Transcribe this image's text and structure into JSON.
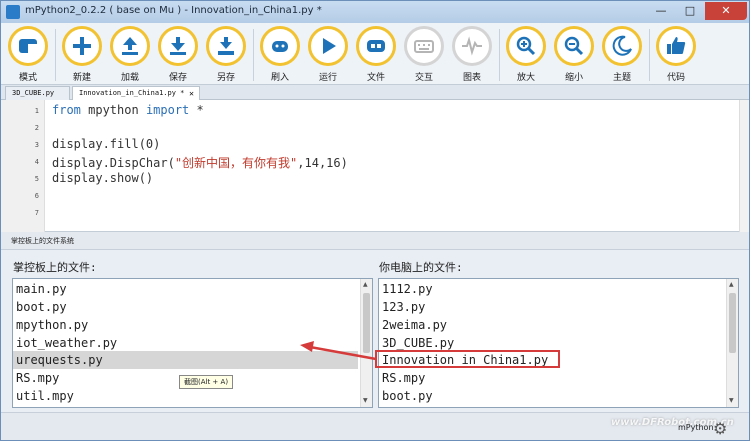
{
  "window": {
    "title": "mPython2_0.2.2 ( base on Mu ) - Innovation_in_China1.py *",
    "minimize": "—",
    "maximize": "□",
    "close": "✕"
  },
  "toolbar": {
    "buttons": [
      {
        "label": "模式",
        "icon": "mode-icon"
      },
      {
        "label": "新建",
        "icon": "plus-icon"
      },
      {
        "label": "加载",
        "icon": "upload-icon"
      },
      {
        "label": "保存",
        "icon": "download-icon"
      },
      {
        "label": "另存",
        "icon": "save-as-icon"
      },
      {
        "label": "刷入",
        "icon": "flash-icon"
      },
      {
        "label": "运行",
        "icon": "play-icon"
      },
      {
        "label": "文件",
        "icon": "files-icon"
      },
      {
        "label": "交互",
        "icon": "keyboard-icon"
      },
      {
        "label": "图表",
        "icon": "plotter-icon"
      },
      {
        "label": "放大",
        "icon": "zoom-in-icon"
      },
      {
        "label": "缩小",
        "icon": "zoom-out-icon"
      },
      {
        "label": "主题",
        "icon": "moon-icon"
      },
      {
        "label": "代码",
        "icon": "thumbs-up-icon"
      }
    ]
  },
  "tabs": [
    {
      "label": "3D_CUBE.py",
      "close": ""
    },
    {
      "label": "Innovation_in_China1.py *",
      "close": "✕"
    }
  ],
  "editor": {
    "line_numbers": [
      "1",
      "2",
      "3",
      "4",
      "5",
      "6",
      "7"
    ],
    "lines": [
      {
        "kw": "from",
        "mid": " mpython ",
        "kw2": "import",
        "rest": " *"
      },
      {
        "text": ""
      },
      {
        "text": "display.fill(0)"
      },
      {
        "pre": "display.DispChar(",
        "str": "\"创新中国，有你有我\"",
        "post": ",14,16)"
      },
      {
        "text": "display.show()"
      },
      {
        "text": ""
      },
      {
        "text": ""
      }
    ]
  },
  "files_panel": {
    "header": "掌控板上的文件系统",
    "device_title": "掌控板上的文件:",
    "computer_title": "你电脑上的文件:",
    "device_files": [
      "main.py",
      "boot.py",
      "mpython.py",
      "iot_weather.py",
      "urequests.py",
      "RS.mpy",
      "util.mpy"
    ],
    "computer_files": [
      "1112.py",
      "123.py",
      "2weima.py",
      "3D_CUBE.py",
      "Innovation_in_China1.py",
      "RS.mpy",
      "boot.py"
    ],
    "selected_device_file": "urequests.py",
    "tooltip": "截图(Alt + A)"
  },
  "status": {
    "mode": "mPython",
    "watermark": "www.DFRobot.com.cn"
  },
  "colors": {
    "accent": "#f2c230",
    "highlight": "#d63b3b",
    "arrow": "#d63b3b"
  }
}
